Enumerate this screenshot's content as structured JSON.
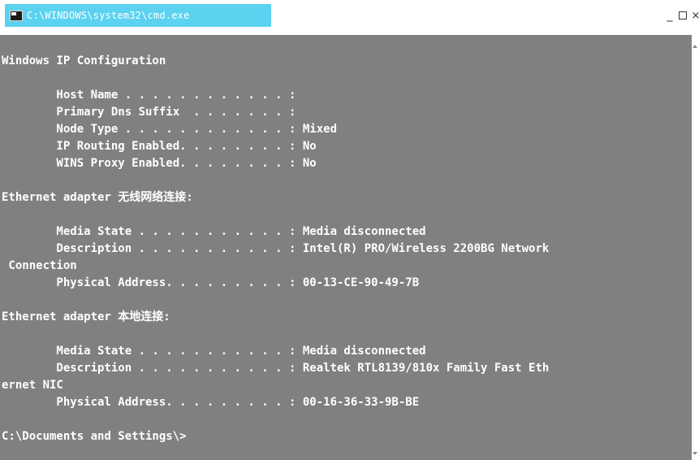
{
  "window": {
    "title": "C:\\WINDOWS\\system32\\cmd.exe",
    "controls": {
      "minimize": "_",
      "close": "×"
    }
  },
  "console": {
    "lines": [
      "Windows IP Configuration",
      "",
      "        Host Name . . . . . . . . . . . . :",
      "        Primary Dns Suffix  . . . . . . . :",
      "        Node Type . . . . . . . . . . . . : Mixed",
      "        IP Routing Enabled. . . . . . . . : No",
      "        WINS Proxy Enabled. . . . . . . . : No",
      "",
      "Ethernet adapter 无线网络连接:",
      "",
      "        Media State . . . . . . . . . . . : Media disconnected",
      "        Description . . . . . . . . . . . : Intel(R) PRO/Wireless 2200BG Network",
      " Connection",
      "        Physical Address. . . . . . . . . : 00-13-CE-90-49-7B",
      "",
      "Ethernet adapter 本地连接:",
      "",
      "        Media State . . . . . . . . . . . : Media disconnected",
      "        Description . . . . . . . . . . . : Realtek RTL8139/810x Family Fast Eth",
      "ernet NIC",
      "        Physical Address. . . . . . . . . : 00-16-36-33-9B-BE",
      "",
      "C:\\Documents and Settings\\>"
    ]
  },
  "colors": {
    "title_tab": "#5ad2f0",
    "console_background": "#808080",
    "console_text": "#ffffff"
  },
  "icons": {
    "app": "cmd-console-icon",
    "maximize": "maximize-square-icon",
    "scroll_up": "scroll-up-arrow-icon",
    "scroll_down": "scroll-down-arrow-icon"
  }
}
